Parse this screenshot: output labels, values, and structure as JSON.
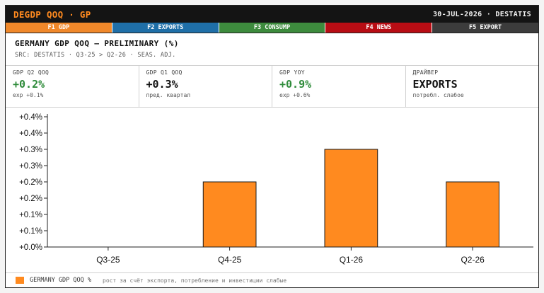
{
  "header": {
    "ticker": "DEGDP QOQ · GP",
    "meta": "30-JUL-2026 · DESTATIS"
  },
  "tabs": [
    {
      "label": "F1 GDP",
      "color": "#f0882a"
    },
    {
      "label": "F2 EXPORTS",
      "color": "#1f6fa8"
    },
    {
      "label": "F3 CONSUMP",
      "color": "#3d8b3d"
    },
    {
      "label": "F4 NEWS",
      "color": "#b80d14"
    },
    {
      "label": "F5 EXPORT",
      "color": "#3c3c3c"
    }
  ],
  "panel": {
    "title": "GERMANY GDP QOQ — PRELIMINARY (%)",
    "subtitle": "SRC: DESTATIS · Q3-25 > Q2-26 · SEAS. ADJ."
  },
  "kpis": [
    {
      "label": "GDP Q2 QOQ",
      "value": "+0.2%",
      "note": "exp +0.1%",
      "tone": "green"
    },
    {
      "label": "GDP Q1 QOQ",
      "value": "+0.3%",
      "note": "пред. квартал",
      "tone": "dark"
    },
    {
      "label": "GDP YOY",
      "value": "+0.9%",
      "note": "exp +0.6%",
      "tone": "green"
    },
    {
      "label": "ДРАЙВЕР",
      "value": "EXPORTS",
      "note": "потребл. слабое",
      "tone": "dark"
    }
  ],
  "chart_data": {
    "type": "bar",
    "categories": [
      "Q3-25",
      "Q4-25",
      "Q1-26",
      "Q2-26"
    ],
    "series": [
      {
        "name": "GERMANY GDP QOQ %",
        "values": [
          0.0,
          0.2,
          0.3,
          0.2
        ],
        "color": "#ff8a1f"
      }
    ],
    "yticks": [
      "+0.0%",
      "+0.1%",
      "+0.1%",
      "+0.2%",
      "+0.2%",
      "+0.3%",
      "+0.3%",
      "+0.4%",
      "+0.4%"
    ],
    "ylim": [
      0,
      0.4
    ],
    "grid": false,
    "legend": "bottom-left"
  },
  "legend": {
    "note": "рост за счёт экспорта, потребление и инвестиции слабые"
  }
}
